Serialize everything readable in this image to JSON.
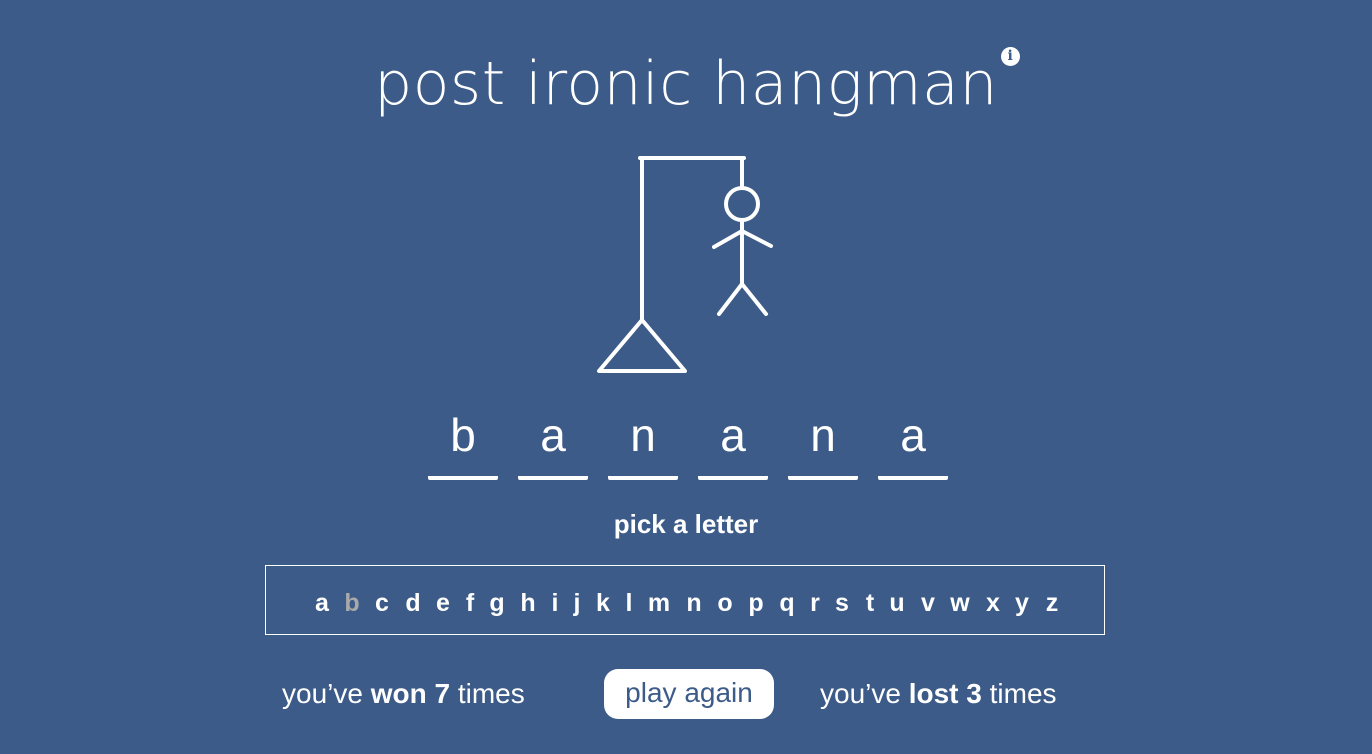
{
  "header": {
    "title": "post ironic hangman",
    "info_icon": "info-icon",
    "info_glyph": "i"
  },
  "game": {
    "wrong_guesses": 6,
    "word_letters": [
      "b",
      "a",
      "n",
      "a",
      "n",
      "a"
    ],
    "prompt": "pick a letter",
    "alphabet": [
      {
        "letter": "a",
        "used": false
      },
      {
        "letter": "b",
        "used": true
      },
      {
        "letter": "c",
        "used": false
      },
      {
        "letter": "d",
        "used": false
      },
      {
        "letter": "e",
        "used": false
      },
      {
        "letter": "f",
        "used": false
      },
      {
        "letter": "g",
        "used": false
      },
      {
        "letter": "h",
        "used": false
      },
      {
        "letter": "i",
        "used": false
      },
      {
        "letter": "j",
        "used": false
      },
      {
        "letter": "k",
        "used": false
      },
      {
        "letter": "l",
        "used": false
      },
      {
        "letter": "m",
        "used": false
      },
      {
        "letter": "n",
        "used": false
      },
      {
        "letter": "o",
        "used": false
      },
      {
        "letter": "p",
        "used": false
      },
      {
        "letter": "q",
        "used": false
      },
      {
        "letter": "r",
        "used": false
      },
      {
        "letter": "s",
        "used": false
      },
      {
        "letter": "t",
        "used": false
      },
      {
        "letter": "u",
        "used": false
      },
      {
        "letter": "v",
        "used": false
      },
      {
        "letter": "w",
        "used": false
      },
      {
        "letter": "x",
        "used": false
      },
      {
        "letter": "y",
        "used": false
      },
      {
        "letter": "z",
        "used": false
      }
    ]
  },
  "stats": {
    "won_prefix": "you’ve ",
    "won_label": "won 7",
    "won_suffix": " times",
    "lost_prefix": "you’ve ",
    "lost_label": "lost 3",
    "lost_suffix": " times"
  },
  "actions": {
    "play_again": "play again"
  },
  "colors": {
    "background": "#3c5b88",
    "foreground": "#ffffff",
    "used_letter": "#a9a9a9"
  }
}
